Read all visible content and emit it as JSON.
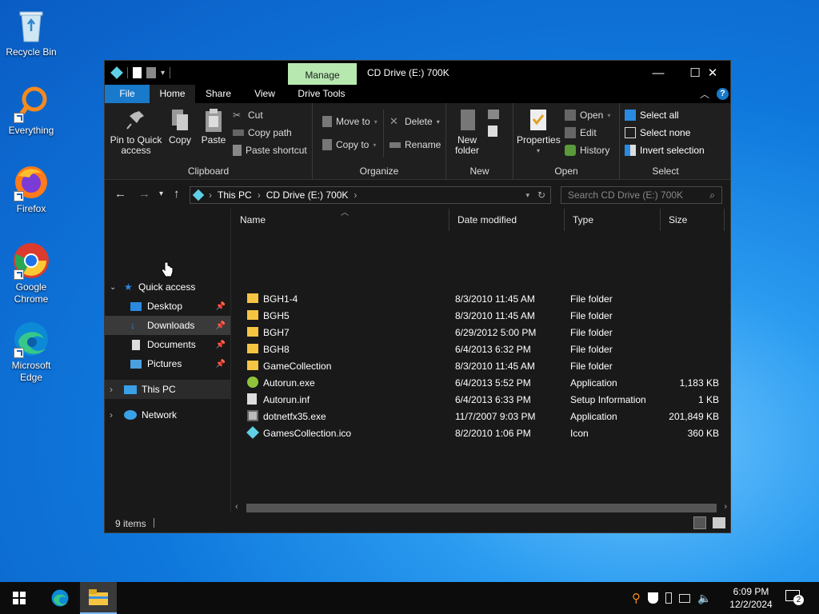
{
  "desktop": {
    "icons": [
      {
        "label": "Recycle Bin",
        "icon": "recycle-bin-icon"
      },
      {
        "label": "Everything",
        "icon": "everything-search-icon"
      },
      {
        "label": "Firefox",
        "icon": "firefox-icon"
      },
      {
        "label": "Google Chrome",
        "icon": "chrome-icon"
      },
      {
        "label": "Microsoft Edge",
        "icon": "edge-icon"
      }
    ]
  },
  "window": {
    "title": "CD Drive (E:) 700K",
    "manage_tab": "Manage",
    "controls": {
      "minimize": "—",
      "maximize": "☐",
      "close": "✕"
    }
  },
  "ribbon": {
    "tabs": [
      "File",
      "Home",
      "Share",
      "View",
      "Drive Tools"
    ],
    "clipboard": {
      "pin": "Pin to Quick access",
      "copy": "Copy",
      "paste": "Paste",
      "cut": "Cut",
      "copy_path": "Copy path",
      "paste_shortcut": "Paste shortcut",
      "label": "Clipboard"
    },
    "organize": {
      "move_to": "Move to",
      "copy_to": "Copy to",
      "delete": "Delete",
      "rename": "Rename",
      "label": "Organize"
    },
    "new": {
      "new_folder": "New folder",
      "label": "New"
    },
    "open": {
      "properties": "Properties",
      "open": "Open",
      "edit": "Edit",
      "history": "History",
      "label": "Open"
    },
    "select": {
      "select_all": "Select all",
      "select_none": "Select none",
      "invert": "Invert selection",
      "label": "Select"
    }
  },
  "address": {
    "crumbs": [
      "This PC",
      "CD Drive (E:) 700K"
    ],
    "search_placeholder": "Search CD Drive (E:) 700K"
  },
  "nav": {
    "quick_access": "Quick access",
    "desktop": "Desktop",
    "downloads": "Downloads",
    "documents": "Documents",
    "pictures": "Pictures",
    "this_pc": "This PC",
    "network": "Network"
  },
  "columns": {
    "name": "Name",
    "date": "Date modified",
    "type": "Type",
    "size": "Size"
  },
  "files": [
    {
      "name": "BGH1-4",
      "date": "8/3/2010 11:45 AM",
      "type": "File folder",
      "size": "",
      "icon": "folder-icon"
    },
    {
      "name": "BGH5",
      "date": "8/3/2010 11:45 AM",
      "type": "File folder",
      "size": "",
      "icon": "folder-icon"
    },
    {
      "name": "BGH7",
      "date": "6/29/2012 5:00 PM",
      "type": "File folder",
      "size": "",
      "icon": "folder-icon"
    },
    {
      "name": "BGH8",
      "date": "6/4/2013 6:32 PM",
      "type": "File folder",
      "size": "",
      "icon": "folder-icon"
    },
    {
      "name": "GameCollection",
      "date": "8/3/2010 11:45 AM",
      "type": "File folder",
      "size": "",
      "icon": "folder-icon"
    },
    {
      "name": "Autorun.exe",
      "date": "6/4/2013 5:52 PM",
      "type": "Application",
      "size": "1,183 KB",
      "icon": "app-icon"
    },
    {
      "name": "Autorun.inf",
      "date": "6/4/2013 6:33 PM",
      "type": "Setup Information",
      "size": "1 KB",
      "icon": "settings-file-icon"
    },
    {
      "name": "dotnetfx35.exe",
      "date": "11/7/2007 9:03 PM",
      "type": "Application",
      "size": "201,849 KB",
      "icon": "installer-icon"
    },
    {
      "name": "GamesCollection.ico",
      "date": "8/2/2010 1:06 PM",
      "type": "Icon",
      "size": "360 KB",
      "icon": "cube-icon"
    }
  ],
  "status": {
    "items": "9 items"
  },
  "taskbar": {
    "time": "6:09 PM",
    "date": "12/2/2024",
    "notifications": "2"
  }
}
